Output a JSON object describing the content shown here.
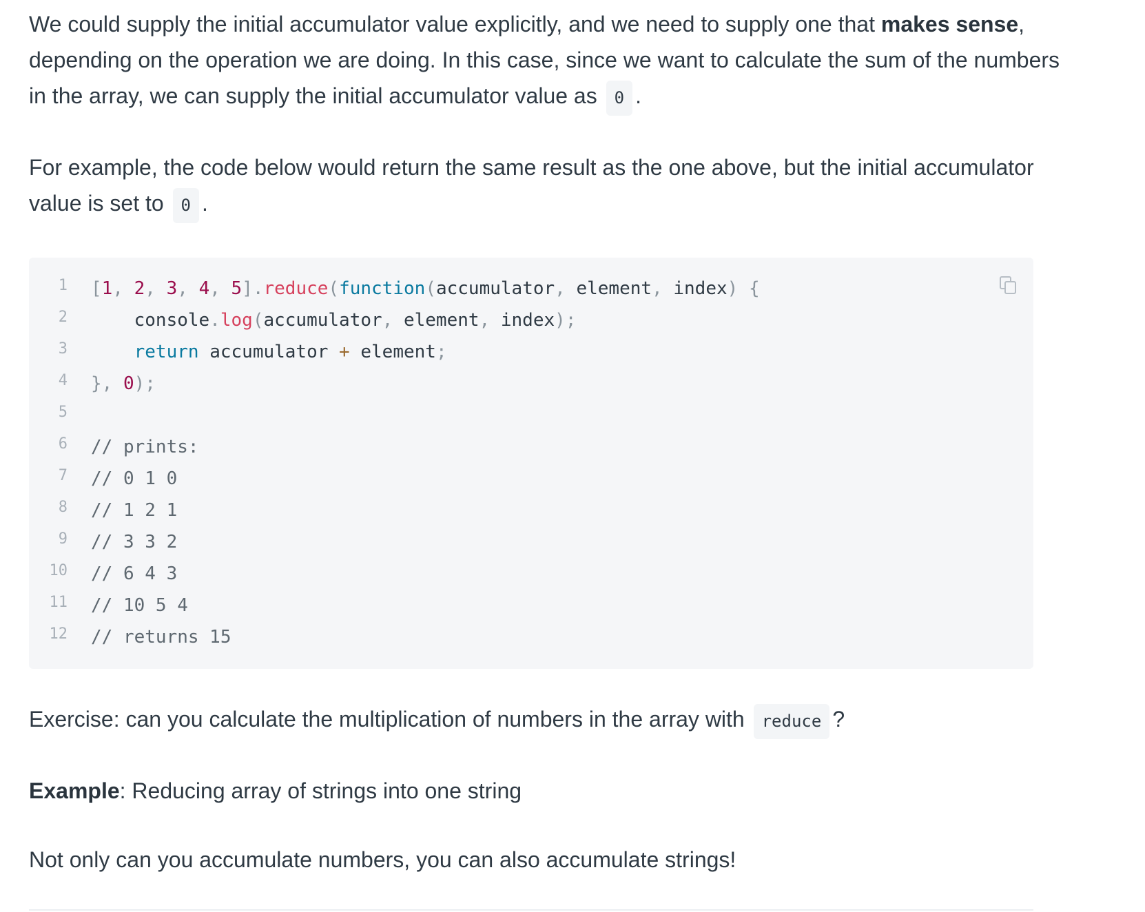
{
  "paragraphs": {
    "p1_a": "We could supply the initial accumulator value explicitly, and we need to supply one that ",
    "p1_bold": "makes sense",
    "p1_b": ", depending on the operation we are doing. In this case, since we want to calculate the sum of the numbers in the array, we can supply the initial accumulator value as",
    "p1_code": "0",
    "p1_c": ".",
    "p2_a": "For example, the code below would return the same result as the one above, but the initial accumulator value is set to",
    "p2_code": "0",
    "p2_b": ".",
    "p3_a": "Exercise: can you calculate the multiplication of numbers in the array with",
    "p3_code": "reduce",
    "p3_b": "?",
    "p4_bold": "Example",
    "p4_rest": ": Reducing array of strings into one string",
    "p5": "Not only can you accumulate numbers, you can also accumulate strings!"
  },
  "code_block": {
    "line_numbers": [
      "1",
      "2",
      "3",
      "4",
      "5",
      "6",
      "7",
      "8",
      "9",
      "10",
      "11",
      "12"
    ],
    "lines": [
      [
        {
          "t": "punc",
          "v": "["
        },
        {
          "t": "num",
          "v": "1"
        },
        {
          "t": "punc",
          "v": ", "
        },
        {
          "t": "num",
          "v": "2"
        },
        {
          "t": "punc",
          "v": ", "
        },
        {
          "t": "num",
          "v": "3"
        },
        {
          "t": "punc",
          "v": ", "
        },
        {
          "t": "num",
          "v": "4"
        },
        {
          "t": "punc",
          "v": ", "
        },
        {
          "t": "num",
          "v": "5"
        },
        {
          "t": "punc",
          "v": "]."
        },
        {
          "t": "fn",
          "v": "reduce"
        },
        {
          "t": "punc",
          "v": "("
        },
        {
          "t": "kw",
          "v": "function"
        },
        {
          "t": "punc",
          "v": "("
        },
        {
          "t": "txt",
          "v": "accumulator"
        },
        {
          "t": "punc",
          "v": ", "
        },
        {
          "t": "txt",
          "v": "element"
        },
        {
          "t": "punc",
          "v": ", "
        },
        {
          "t": "txt",
          "v": "index"
        },
        {
          "t": "punc",
          "v": ") {"
        }
      ],
      [
        {
          "t": "txt",
          "v": "    console"
        },
        {
          "t": "punc",
          "v": "."
        },
        {
          "t": "fn",
          "v": "log"
        },
        {
          "t": "punc",
          "v": "("
        },
        {
          "t": "txt",
          "v": "accumulator"
        },
        {
          "t": "punc",
          "v": ", "
        },
        {
          "t": "txt",
          "v": "element"
        },
        {
          "t": "punc",
          "v": ", "
        },
        {
          "t": "txt",
          "v": "index"
        },
        {
          "t": "punc",
          "v": ");"
        }
      ],
      [
        {
          "t": "txt",
          "v": "    "
        },
        {
          "t": "kw",
          "v": "return"
        },
        {
          "t": "txt",
          "v": " accumulator "
        },
        {
          "t": "op",
          "v": "+"
        },
        {
          "t": "txt",
          "v": " element"
        },
        {
          "t": "punc",
          "v": ";"
        }
      ],
      [
        {
          "t": "punc",
          "v": "}, "
        },
        {
          "t": "num",
          "v": "0"
        },
        {
          "t": "punc",
          "v": ");"
        }
      ],
      [],
      [
        {
          "t": "com",
          "v": "// prints:"
        }
      ],
      [
        {
          "t": "com",
          "v": "// 0 1 0"
        }
      ],
      [
        {
          "t": "com",
          "v": "// 1 2 1"
        }
      ],
      [
        {
          "t": "com",
          "v": "// 3 3 2"
        }
      ],
      [
        {
          "t": "com",
          "v": "// 6 4 3"
        }
      ],
      [
        {
          "t": "com",
          "v": "// 10 5 4"
        }
      ],
      [
        {
          "t": "com",
          "v": "// returns 15"
        }
      ]
    ],
    "copy_icon": "copy-icon"
  },
  "colors": {
    "text": "#2f3a44",
    "code_bg": "#f5f6f8",
    "number": "#9a0d4c",
    "function_name": "#d6415d",
    "keyword": "#0a7aa0",
    "operator": "#9a6a2f",
    "punctuation": "#8a949c",
    "comment": "#5e6870",
    "line_number": "#a8b0b8"
  }
}
